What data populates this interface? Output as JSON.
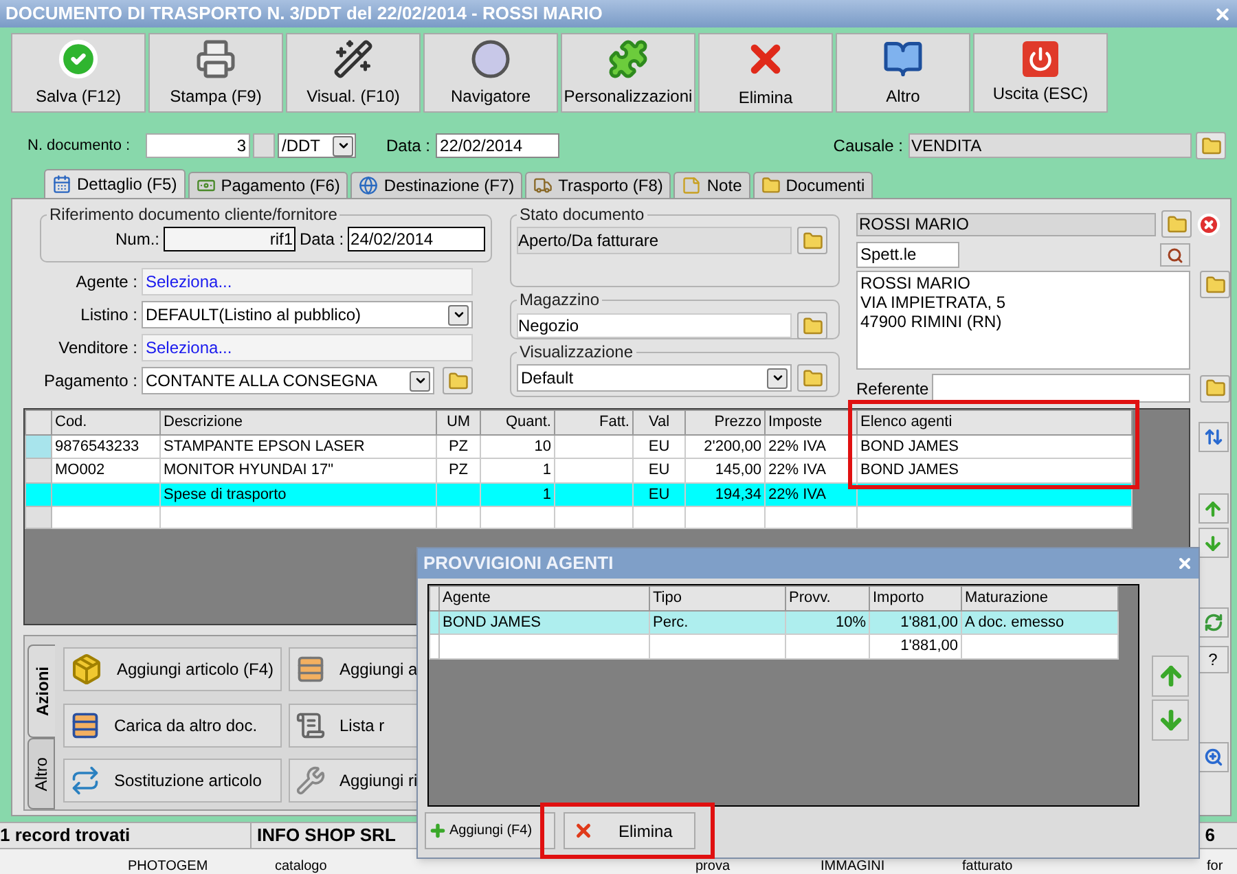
{
  "window": {
    "title": "DOCUMENTO DI TRASPORTO N. 3/DDT del 22/02/2014 - ROSSI MARIO"
  },
  "toolbar": [
    {
      "label": "Salva (F12)"
    },
    {
      "label": "Stampa (F9)"
    },
    {
      "label": "Visual. (F10)"
    },
    {
      "label": "Navigatore"
    },
    {
      "label": "Personalizzazioni"
    },
    {
      "label": "Elimina"
    },
    {
      "label": "Altro"
    },
    {
      "label": "Uscita (ESC)"
    }
  ],
  "header": {
    "number_label": "N. documento :",
    "number": "3",
    "series": "/DDT",
    "date_label": "Data :",
    "date": "22/02/2014",
    "causale_label": "Causale :",
    "causale": "VENDITA"
  },
  "tabs": [
    {
      "label": "Dettaglio (F5)",
      "selected": true
    },
    {
      "label": "Pagamento (F6)",
      "selected": false
    },
    {
      "label": "Destinazione (F7)",
      "selected": false
    },
    {
      "label": "Trasporto (F8)",
      "selected": false
    },
    {
      "label": "Note",
      "selected": false
    },
    {
      "label": "Documenti",
      "selected": false
    }
  ],
  "reference": {
    "title": "Riferimento documento cliente/fornitore",
    "num_label": "Num.:",
    "num": "rif1",
    "date_label": "Data :",
    "date": "24/02/2014"
  },
  "fields": [
    {
      "label": "Agente :",
      "value": "Seleziona...",
      "kind": "link"
    },
    {
      "label": "Listino :",
      "value": "DEFAULT(Listino al pubblico)",
      "kind": "select"
    },
    {
      "label": "Venditore :",
      "value": "Seleziona...",
      "kind": "link"
    },
    {
      "label": "Pagamento :",
      "value": "CONTANTE ALLA CONSEGNA",
      "kind": "select_folder"
    }
  ],
  "status_group": {
    "title": "Stato documento",
    "value": "Aperto/Da fatturare"
  },
  "warehouse": {
    "title": "Magazzino",
    "value": "Negozio"
  },
  "view": {
    "title": "Visualizzazione",
    "value": "Default"
  },
  "customer": {
    "name": "ROSSI MARIO",
    "salutation": "Spett.le",
    "address": [
      "ROSSI MARIO",
      "VIA IMPIETRATA, 5",
      "47900 RIMINI (RN)"
    ],
    "referente_label": "Referente"
  },
  "lines_table": {
    "columns": [
      "Cod.",
      "Descrizione",
      "UM",
      "Quant.",
      "Fatt.",
      "Val",
      "Prezzo",
      "Imposte",
      "Elenco agenti"
    ],
    "rows": [
      {
        "cod": "9876543233",
        "descrizione": "STAMPANTE EPSON LASER",
        "um": "PZ",
        "quant": "10",
        "val": "EU",
        "prezzo": "2'200,00",
        "imposte": "22% IVA",
        "agenti": "BOND JAMES",
        "selected": false,
        "current": true
      },
      {
        "cod": "MO002",
        "descrizione": "MONITOR HYUNDAI 17\"",
        "um": "PZ",
        "quant": "1",
        "val": "EU",
        "prezzo": "145,00",
        "imposte": "22% IVA",
        "agenti": "BOND JAMES",
        "selected": false,
        "current": false
      },
      {
        "descrizione": "Spese di trasporto",
        "quant": "1",
        "val": "EU",
        "prezzo": "194,34",
        "imposte": "22% IVA",
        "selected": true,
        "current": false
      }
    ]
  },
  "side_help": "?",
  "actions": {
    "tabs": [
      {
        "label": "Azioni",
        "selected": true
      },
      {
        "label": "Altro",
        "selected": false
      }
    ],
    "buttons": [
      "Aggiungi articolo (F4)",
      "Aggiungi a",
      "Carica da altro doc.",
      "Lista r",
      "Sostituzione articolo",
      "Aggiungi ri"
    ]
  },
  "status_bar": [
    "1 record trovati",
    "INFO SHOP SRL",
    "6"
  ],
  "background_texts": [
    "PHOTOGEM",
    "catalogo",
    "prova",
    "IMMAGINI",
    "fatturato",
    "for"
  ],
  "popup": {
    "title": "PROVVIGIONI AGENTI",
    "columns": [
      "Agente",
      "Tipo",
      "Provv.",
      "Importo",
      "Maturazione"
    ],
    "rows": [
      {
        "cells": [
          "BOND JAMES",
          "Perc.",
          "10%",
          "1'881,00",
          "A doc. emesso"
        ],
        "selected": true
      }
    ],
    "total": "1'881,00",
    "buttons": [
      "Aggiungi (F4)",
      "Elimina"
    ]
  }
}
